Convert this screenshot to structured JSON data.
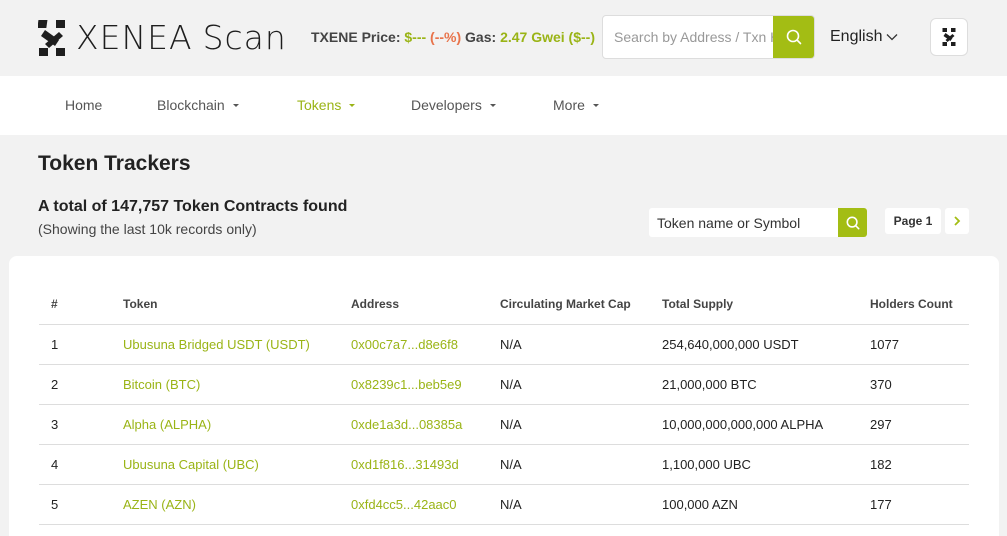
{
  "brand": {
    "name": "XENEA",
    "suffix": "Scan"
  },
  "ticker": {
    "price_label": "TXENE Price:",
    "price_value": "$---",
    "price_change": "(--%)",
    "gas_label": "Gas:",
    "gas_value": "2.47 Gwei ($--)"
  },
  "header_search": {
    "placeholder": "Search by Address / Txn Hash / Block / Token"
  },
  "language": {
    "selected": "English"
  },
  "nav": {
    "home": "Home",
    "blockchain": "Blockchain",
    "tokens": "Tokens",
    "developers": "Developers",
    "more": "More"
  },
  "page": {
    "title": "Token Trackers",
    "total": "A total of 147,757 Token Contracts found",
    "subtitle": "(Showing the last 10k records only)"
  },
  "token_search": {
    "placeholder": "Token name or Symbol"
  },
  "pagination": {
    "label": "Page 1"
  },
  "table": {
    "headers": [
      "#",
      "Token",
      "Address",
      "Circulating Market Cap",
      "Total Supply",
      "Holders Count"
    ],
    "rows": [
      {
        "num": "1",
        "token": "Ubusuna Bridged USDT (USDT)",
        "address": "0x00c7a7...d8e6f8",
        "market_cap": "N/A",
        "supply": "254,640,000,000 USDT",
        "holders": "1077"
      },
      {
        "num": "2",
        "token": "Bitcoin (BTC)",
        "address": "0x8239c1...beb5e9",
        "market_cap": "N/A",
        "supply": "21,000,000 BTC",
        "holders": "370"
      },
      {
        "num": "3",
        "token": "Alpha (ALPHA)",
        "address": "0xde1a3d...08385a",
        "market_cap": "N/A",
        "supply": "10,000,000,000,000 ALPHA",
        "holders": "297"
      },
      {
        "num": "4",
        "token": "Ubusuna Capital (UBC)",
        "address": "0xd1f816...31493d",
        "market_cap": "N/A",
        "supply": "1,100,000 UBC",
        "holders": "182"
      },
      {
        "num": "5",
        "token": "AZEN (AZN)",
        "address": "0xfd4cc5...42aac0",
        "market_cap": "N/A",
        "supply": "100,000 AZN",
        "holders": "177"
      }
    ]
  },
  "colors": {
    "accent": "#a3bd14",
    "link": "#9ab416",
    "price_change": "#e8734a"
  },
  "icons": {
    "logo": "xenea-logo-icon",
    "search": "search-icon",
    "chevron": "chevron-down-icon",
    "app": "xenea-app-icon",
    "next": "chevron-right-icon"
  }
}
